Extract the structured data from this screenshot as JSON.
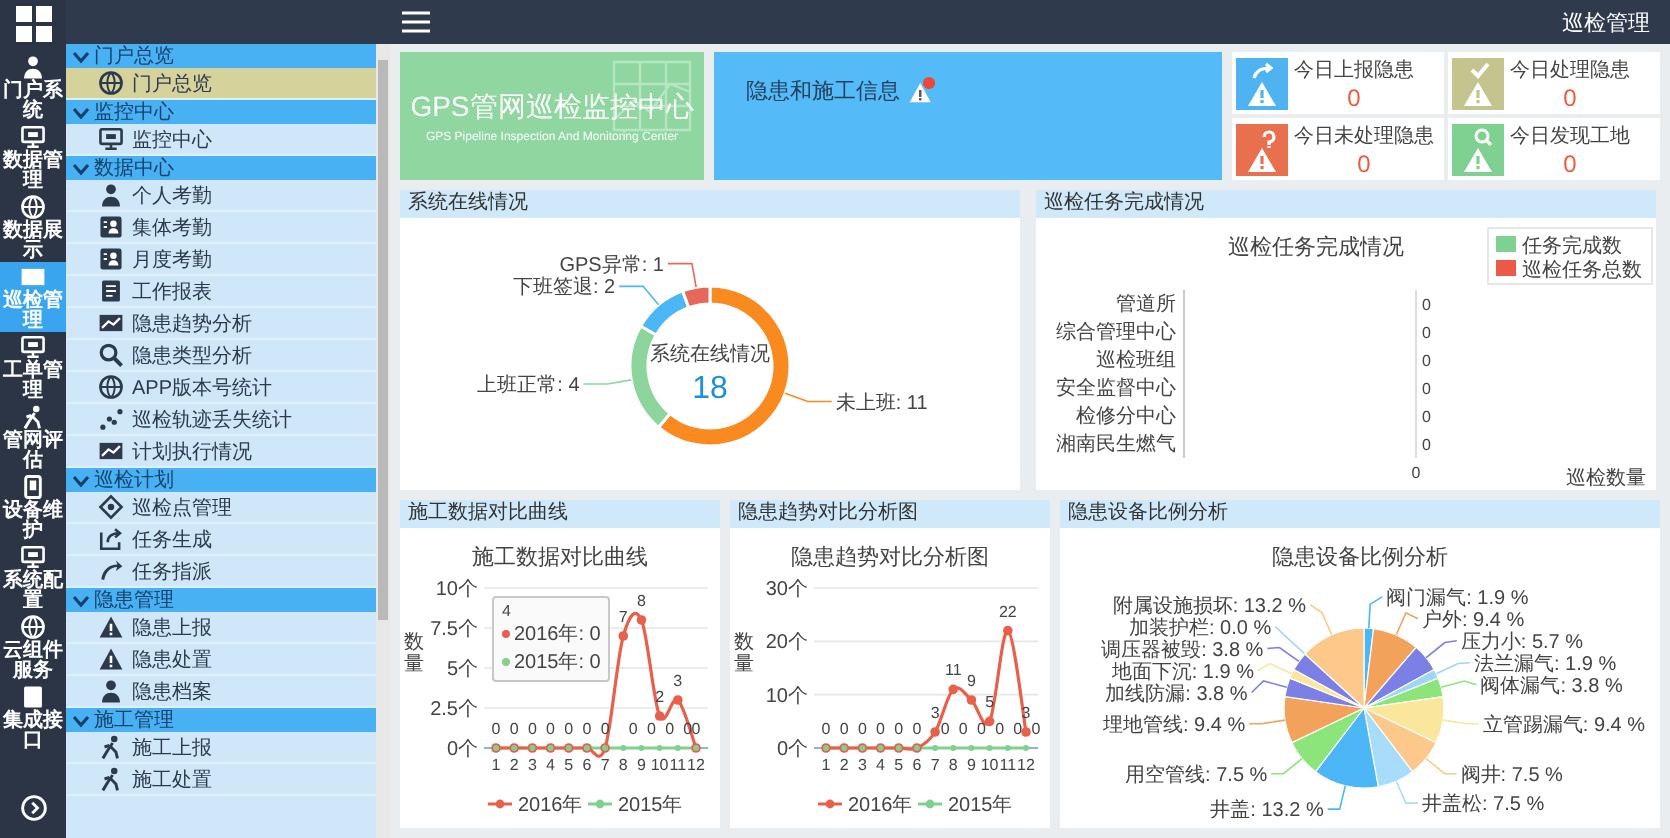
{
  "top_bar": {
    "title": "巡检管理"
  },
  "rail": [
    {
      "label": "门户系统",
      "selected": false
    },
    {
      "label": "数据管理",
      "selected": false
    },
    {
      "label": "数据展示",
      "selected": false
    },
    {
      "label": "巡检管理",
      "selected": true
    },
    {
      "label": "工单管理",
      "selected": false
    },
    {
      "label": "管网评估",
      "selected": false
    },
    {
      "label": "设备维护",
      "selected": false
    },
    {
      "label": "系统配置",
      "selected": false
    },
    {
      "label": "云组件服务",
      "selected": false
    },
    {
      "label": "集成接口",
      "selected": false
    }
  ],
  "sidebar": [
    {
      "label": "门户总览",
      "expanded": true,
      "children": [
        {
          "label": "门户总览",
          "selected": true
        }
      ]
    },
    {
      "label": "监控中心",
      "expanded": true,
      "children": [
        {
          "label": "监控中心",
          "selected": false
        }
      ]
    },
    {
      "label": "数据中心",
      "expanded": true,
      "children": [
        {
          "label": "个人考勤",
          "selected": false
        },
        {
          "label": "集体考勤",
          "selected": false
        },
        {
          "label": "月度考勤",
          "selected": false
        },
        {
          "label": "工作报表",
          "selected": false
        },
        {
          "label": "隐患趋势分析",
          "selected": false
        },
        {
          "label": "隐患类型分析",
          "selected": false
        },
        {
          "label": "APP版本号统计",
          "selected": false
        },
        {
          "label": "巡检轨迹丢失统计",
          "selected": false
        },
        {
          "label": "计划执行情况",
          "selected": false
        }
      ]
    },
    {
      "label": "巡检计划",
      "expanded": true,
      "children": [
        {
          "label": "巡检点管理",
          "selected": false
        },
        {
          "label": "任务生成",
          "selected": false
        },
        {
          "label": "任务指派",
          "selected": false
        }
      ]
    },
    {
      "label": "隐患管理",
      "expanded": true,
      "children": [
        {
          "label": "隐患上报",
          "selected": false
        },
        {
          "label": "隐患处置",
          "selected": false
        },
        {
          "label": "隐患档案",
          "selected": false
        }
      ]
    },
    {
      "label": "施工管理",
      "expanded": true,
      "children": [
        {
          "label": "施工上报",
          "selected": false
        },
        {
          "label": "施工处置",
          "selected": false
        }
      ]
    }
  ],
  "banner": {
    "title": "GPS管网巡检监控中心",
    "subtitle": "GPS Pipeline Inspection And Monitoring Center"
  },
  "notice": {
    "title": "隐患和施工信息"
  },
  "stats": [
    {
      "kind": "report",
      "label": "今日上报隐患",
      "value": "0",
      "color": "#4fb3f2"
    },
    {
      "kind": "handled",
      "label": "今日处理隐患",
      "value": "0",
      "color": "#c4c58e"
    },
    {
      "kind": "pending",
      "label": "今日未处理隐患",
      "value": "0",
      "color": "#e8704f"
    },
    {
      "kind": "site",
      "label": "今日发现工地",
      "value": "0",
      "color": "#7fd191"
    }
  ],
  "online": {
    "header": "系统在线情况",
    "total": "18",
    "chart_data": {
      "type": "donut",
      "title": "系统在线情况",
      "categories": [
        "未上班",
        "上班正常",
        "下班签退",
        "GPS异常"
      ],
      "values": [
        11,
        4,
        2,
        1
      ],
      "colors": [
        "#f98a1f",
        "#8cd59d",
        "#4db6f6",
        "#e7685a"
      ],
      "value_labels": [
        ": 11",
        ": 4",
        ": 2",
        ": 1"
      ]
    }
  },
  "tasks": {
    "header": "巡检任务完成情况",
    "title": "巡检任务完成情况",
    "axis_origin": "0",
    "axis_label": "巡检数量",
    "legend": [
      {
        "name": "任务完成数",
        "color": "#7fd191"
      },
      {
        "name": "巡检任务总数",
        "color": "#ea5a47"
      }
    ],
    "rows": [
      {
        "category": "管道所",
        "value": "0"
      },
      {
        "category": "综合管理中心",
        "value": "0"
      },
      {
        "category": "巡检班组",
        "value": "0"
      },
      {
        "category": "安全监督中心",
        "value": "0"
      },
      {
        "category": "检修分中心",
        "value": "0"
      },
      {
        "category": "湘南民生燃气",
        "value": "0"
      }
    ]
  },
  "construction": {
    "header": "施工数据对比曲线",
    "chart_data": {
      "type": "line",
      "title": "施工数据对比曲线",
      "ylabel": "数量",
      "x": [
        1,
        2,
        3,
        4,
        5,
        6,
        7,
        8,
        9,
        10,
        11,
        12
      ],
      "ylim": [
        0,
        10
      ],
      "grid": true,
      "legend": true,
      "yticks": [
        {
          "value": 0,
          "label": "0个"
        },
        {
          "value": 2.5,
          "label": "2.5个"
        },
        {
          "value": 5,
          "label": "5个"
        },
        {
          "value": 7.5,
          "label": "7.5个"
        },
        {
          "value": 10,
          "label": "10个"
        }
      ],
      "series": [
        {
          "name": "2016年",
          "color": "#e8604c",
          "marker": "circle",
          "values": [
            0,
            0,
            0,
            0,
            0,
            0,
            0,
            7,
            8,
            2,
            3,
            0
          ],
          "value_labels": [
            "0",
            "0",
            "0",
            "0",
            "0",
            "0",
            "0",
            "7",
            "8",
            "2",
            "3",
            "0"
          ]
        },
        {
          "name": "2015年",
          "color": "#7fd191",
          "marker": "circle",
          "values": [
            0,
            0,
            0,
            0,
            0,
            0,
            0,
            0,
            0,
            0,
            0,
            0
          ],
          "value_labels": [
            null,
            null,
            null,
            null,
            null,
            null,
            null,
            "0",
            "0",
            "0",
            "0",
            null
          ]
        }
      ]
    },
    "tooltip": {
      "title": "4",
      "lines": [
        "2016年: 0",
        "2015年: 0"
      ]
    }
  },
  "hazard_trend": {
    "header": "隐患趋势对比分析图",
    "chart_data": {
      "type": "line",
      "title": "隐患趋势对比分析图",
      "ylabel": "数量",
      "x": [
        1,
        2,
        3,
        4,
        5,
        6,
        7,
        8,
        9,
        10,
        11,
        12
      ],
      "ylim": [
        0,
        30
      ],
      "grid": true,
      "legend": true,
      "yticks": [
        {
          "value": 0,
          "label": "0个"
        },
        {
          "value": 10,
          "label": "10个"
        },
        {
          "value": 20,
          "label": "20个"
        },
        {
          "value": 30,
          "label": "30个"
        }
      ],
      "series": [
        {
          "name": "2016年",
          "color": "#e8604c",
          "marker": "circle",
          "values": [
            0,
            0,
            0,
            0,
            0,
            0,
            3,
            11,
            9,
            5,
            22,
            3
          ],
          "value_labels": [
            "0",
            "0",
            "0",
            "0",
            "0",
            "0",
            "3",
            "11",
            "9",
            "5",
            "22",
            "3"
          ]
        },
        {
          "name": "2015年",
          "color": "#7fd191",
          "marker": "circle",
          "values": [
            0,
            0,
            0,
            0,
            0,
            0,
            0,
            0,
            0,
            0,
            0,
            0
          ],
          "value_labels": [
            null,
            null,
            null,
            null,
            null,
            null,
            "0",
            "0",
            "0",
            "0",
            "0",
            "0"
          ]
        }
      ]
    }
  },
  "hazard_devices": {
    "header": "隐患设备比例分析",
    "chart_data": {
      "type": "pie",
      "title": "隐患设备比例分析",
      "categories": [
        "阀门漏气",
        "户外",
        "压力小",
        "法兰漏气",
        "阀体漏气",
        "立管踢漏气",
        "阀井",
        "井盖松",
        "井盖",
        "用空管线",
        "埋地管线",
        "加线防漏",
        "地面下沉",
        "调压器被毁",
        "加装护栏",
        "附属设施损坏"
      ],
      "values": [
        1.9,
        9.4,
        5.7,
        1.9,
        3.8,
        9.4,
        7.5,
        7.5,
        13.2,
        7.5,
        9.4,
        3.8,
        1.9,
        3.8,
        0,
        13.2
      ],
      "colors": [
        "#4db6f6",
        "#f2a25a",
        "#7b7fe6",
        "#9fd6f7",
        "#8ce57a",
        "#fbe79b",
        "#fcc98a",
        "#a8dcfb",
        "#4db6f6",
        "#8ce57a",
        "#f2a25a",
        "#7b7fe6",
        "#fbe79b",
        "#7b7fe6",
        "#9fd6f7",
        "#fcc98a"
      ],
      "value_labels": [
        ": 1.9 %",
        ": 9.4 %",
        ": 5.7 %",
        ": 1.9 %",
        ": 3.8 %",
        ": 9.4 %",
        ": 7.5 %",
        ": 7.5 %",
        ": 13.2 %",
        ": 7.5 %",
        ": 9.4 %",
        ": 3.8 %",
        ": 1.9 %",
        ": 3.8 %",
        ": 0.0 %",
        ": 13.2 %"
      ]
    }
  }
}
